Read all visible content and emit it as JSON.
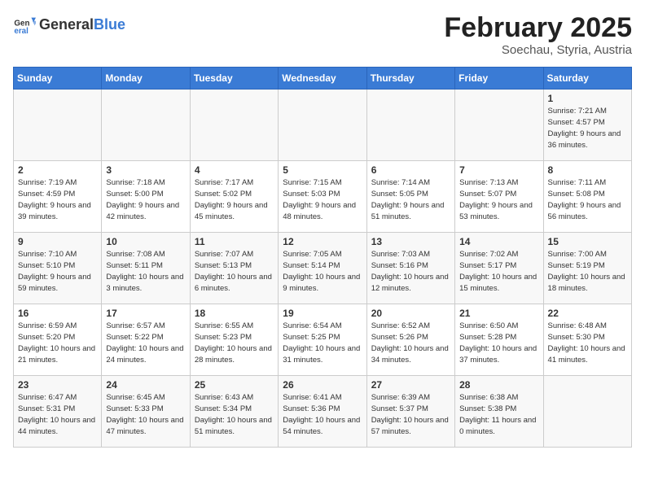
{
  "header": {
    "logo_general": "General",
    "logo_blue": "Blue",
    "month_year": "February 2025",
    "location": "Soechau, Styria, Austria"
  },
  "weekdays": [
    "Sunday",
    "Monday",
    "Tuesday",
    "Wednesday",
    "Thursday",
    "Friday",
    "Saturday"
  ],
  "weeks": [
    [
      {
        "day": "",
        "info": ""
      },
      {
        "day": "",
        "info": ""
      },
      {
        "day": "",
        "info": ""
      },
      {
        "day": "",
        "info": ""
      },
      {
        "day": "",
        "info": ""
      },
      {
        "day": "",
        "info": ""
      },
      {
        "day": "1",
        "info": "Sunrise: 7:21 AM\nSunset: 4:57 PM\nDaylight: 9 hours and 36 minutes."
      }
    ],
    [
      {
        "day": "2",
        "info": "Sunrise: 7:19 AM\nSunset: 4:59 PM\nDaylight: 9 hours and 39 minutes."
      },
      {
        "day": "3",
        "info": "Sunrise: 7:18 AM\nSunset: 5:00 PM\nDaylight: 9 hours and 42 minutes."
      },
      {
        "day": "4",
        "info": "Sunrise: 7:17 AM\nSunset: 5:02 PM\nDaylight: 9 hours and 45 minutes."
      },
      {
        "day": "5",
        "info": "Sunrise: 7:15 AM\nSunset: 5:03 PM\nDaylight: 9 hours and 48 minutes."
      },
      {
        "day": "6",
        "info": "Sunrise: 7:14 AM\nSunset: 5:05 PM\nDaylight: 9 hours and 51 minutes."
      },
      {
        "day": "7",
        "info": "Sunrise: 7:13 AM\nSunset: 5:07 PM\nDaylight: 9 hours and 53 minutes."
      },
      {
        "day": "8",
        "info": "Sunrise: 7:11 AM\nSunset: 5:08 PM\nDaylight: 9 hours and 56 minutes."
      }
    ],
    [
      {
        "day": "9",
        "info": "Sunrise: 7:10 AM\nSunset: 5:10 PM\nDaylight: 9 hours and 59 minutes."
      },
      {
        "day": "10",
        "info": "Sunrise: 7:08 AM\nSunset: 5:11 PM\nDaylight: 10 hours and 3 minutes."
      },
      {
        "day": "11",
        "info": "Sunrise: 7:07 AM\nSunset: 5:13 PM\nDaylight: 10 hours and 6 minutes."
      },
      {
        "day": "12",
        "info": "Sunrise: 7:05 AM\nSunset: 5:14 PM\nDaylight: 10 hours and 9 minutes."
      },
      {
        "day": "13",
        "info": "Sunrise: 7:03 AM\nSunset: 5:16 PM\nDaylight: 10 hours and 12 minutes."
      },
      {
        "day": "14",
        "info": "Sunrise: 7:02 AM\nSunset: 5:17 PM\nDaylight: 10 hours and 15 minutes."
      },
      {
        "day": "15",
        "info": "Sunrise: 7:00 AM\nSunset: 5:19 PM\nDaylight: 10 hours and 18 minutes."
      }
    ],
    [
      {
        "day": "16",
        "info": "Sunrise: 6:59 AM\nSunset: 5:20 PM\nDaylight: 10 hours and 21 minutes."
      },
      {
        "day": "17",
        "info": "Sunrise: 6:57 AM\nSunset: 5:22 PM\nDaylight: 10 hours and 24 minutes."
      },
      {
        "day": "18",
        "info": "Sunrise: 6:55 AM\nSunset: 5:23 PM\nDaylight: 10 hours and 28 minutes."
      },
      {
        "day": "19",
        "info": "Sunrise: 6:54 AM\nSunset: 5:25 PM\nDaylight: 10 hours and 31 minutes."
      },
      {
        "day": "20",
        "info": "Sunrise: 6:52 AM\nSunset: 5:26 PM\nDaylight: 10 hours and 34 minutes."
      },
      {
        "day": "21",
        "info": "Sunrise: 6:50 AM\nSunset: 5:28 PM\nDaylight: 10 hours and 37 minutes."
      },
      {
        "day": "22",
        "info": "Sunrise: 6:48 AM\nSunset: 5:30 PM\nDaylight: 10 hours and 41 minutes."
      }
    ],
    [
      {
        "day": "23",
        "info": "Sunrise: 6:47 AM\nSunset: 5:31 PM\nDaylight: 10 hours and 44 minutes."
      },
      {
        "day": "24",
        "info": "Sunrise: 6:45 AM\nSunset: 5:33 PM\nDaylight: 10 hours and 47 minutes."
      },
      {
        "day": "25",
        "info": "Sunrise: 6:43 AM\nSunset: 5:34 PM\nDaylight: 10 hours and 51 minutes."
      },
      {
        "day": "26",
        "info": "Sunrise: 6:41 AM\nSunset: 5:36 PM\nDaylight: 10 hours and 54 minutes."
      },
      {
        "day": "27",
        "info": "Sunrise: 6:39 AM\nSunset: 5:37 PM\nDaylight: 10 hours and 57 minutes."
      },
      {
        "day": "28",
        "info": "Sunrise: 6:38 AM\nSunset: 5:38 PM\nDaylight: 11 hours and 0 minutes."
      },
      {
        "day": "",
        "info": ""
      }
    ]
  ]
}
